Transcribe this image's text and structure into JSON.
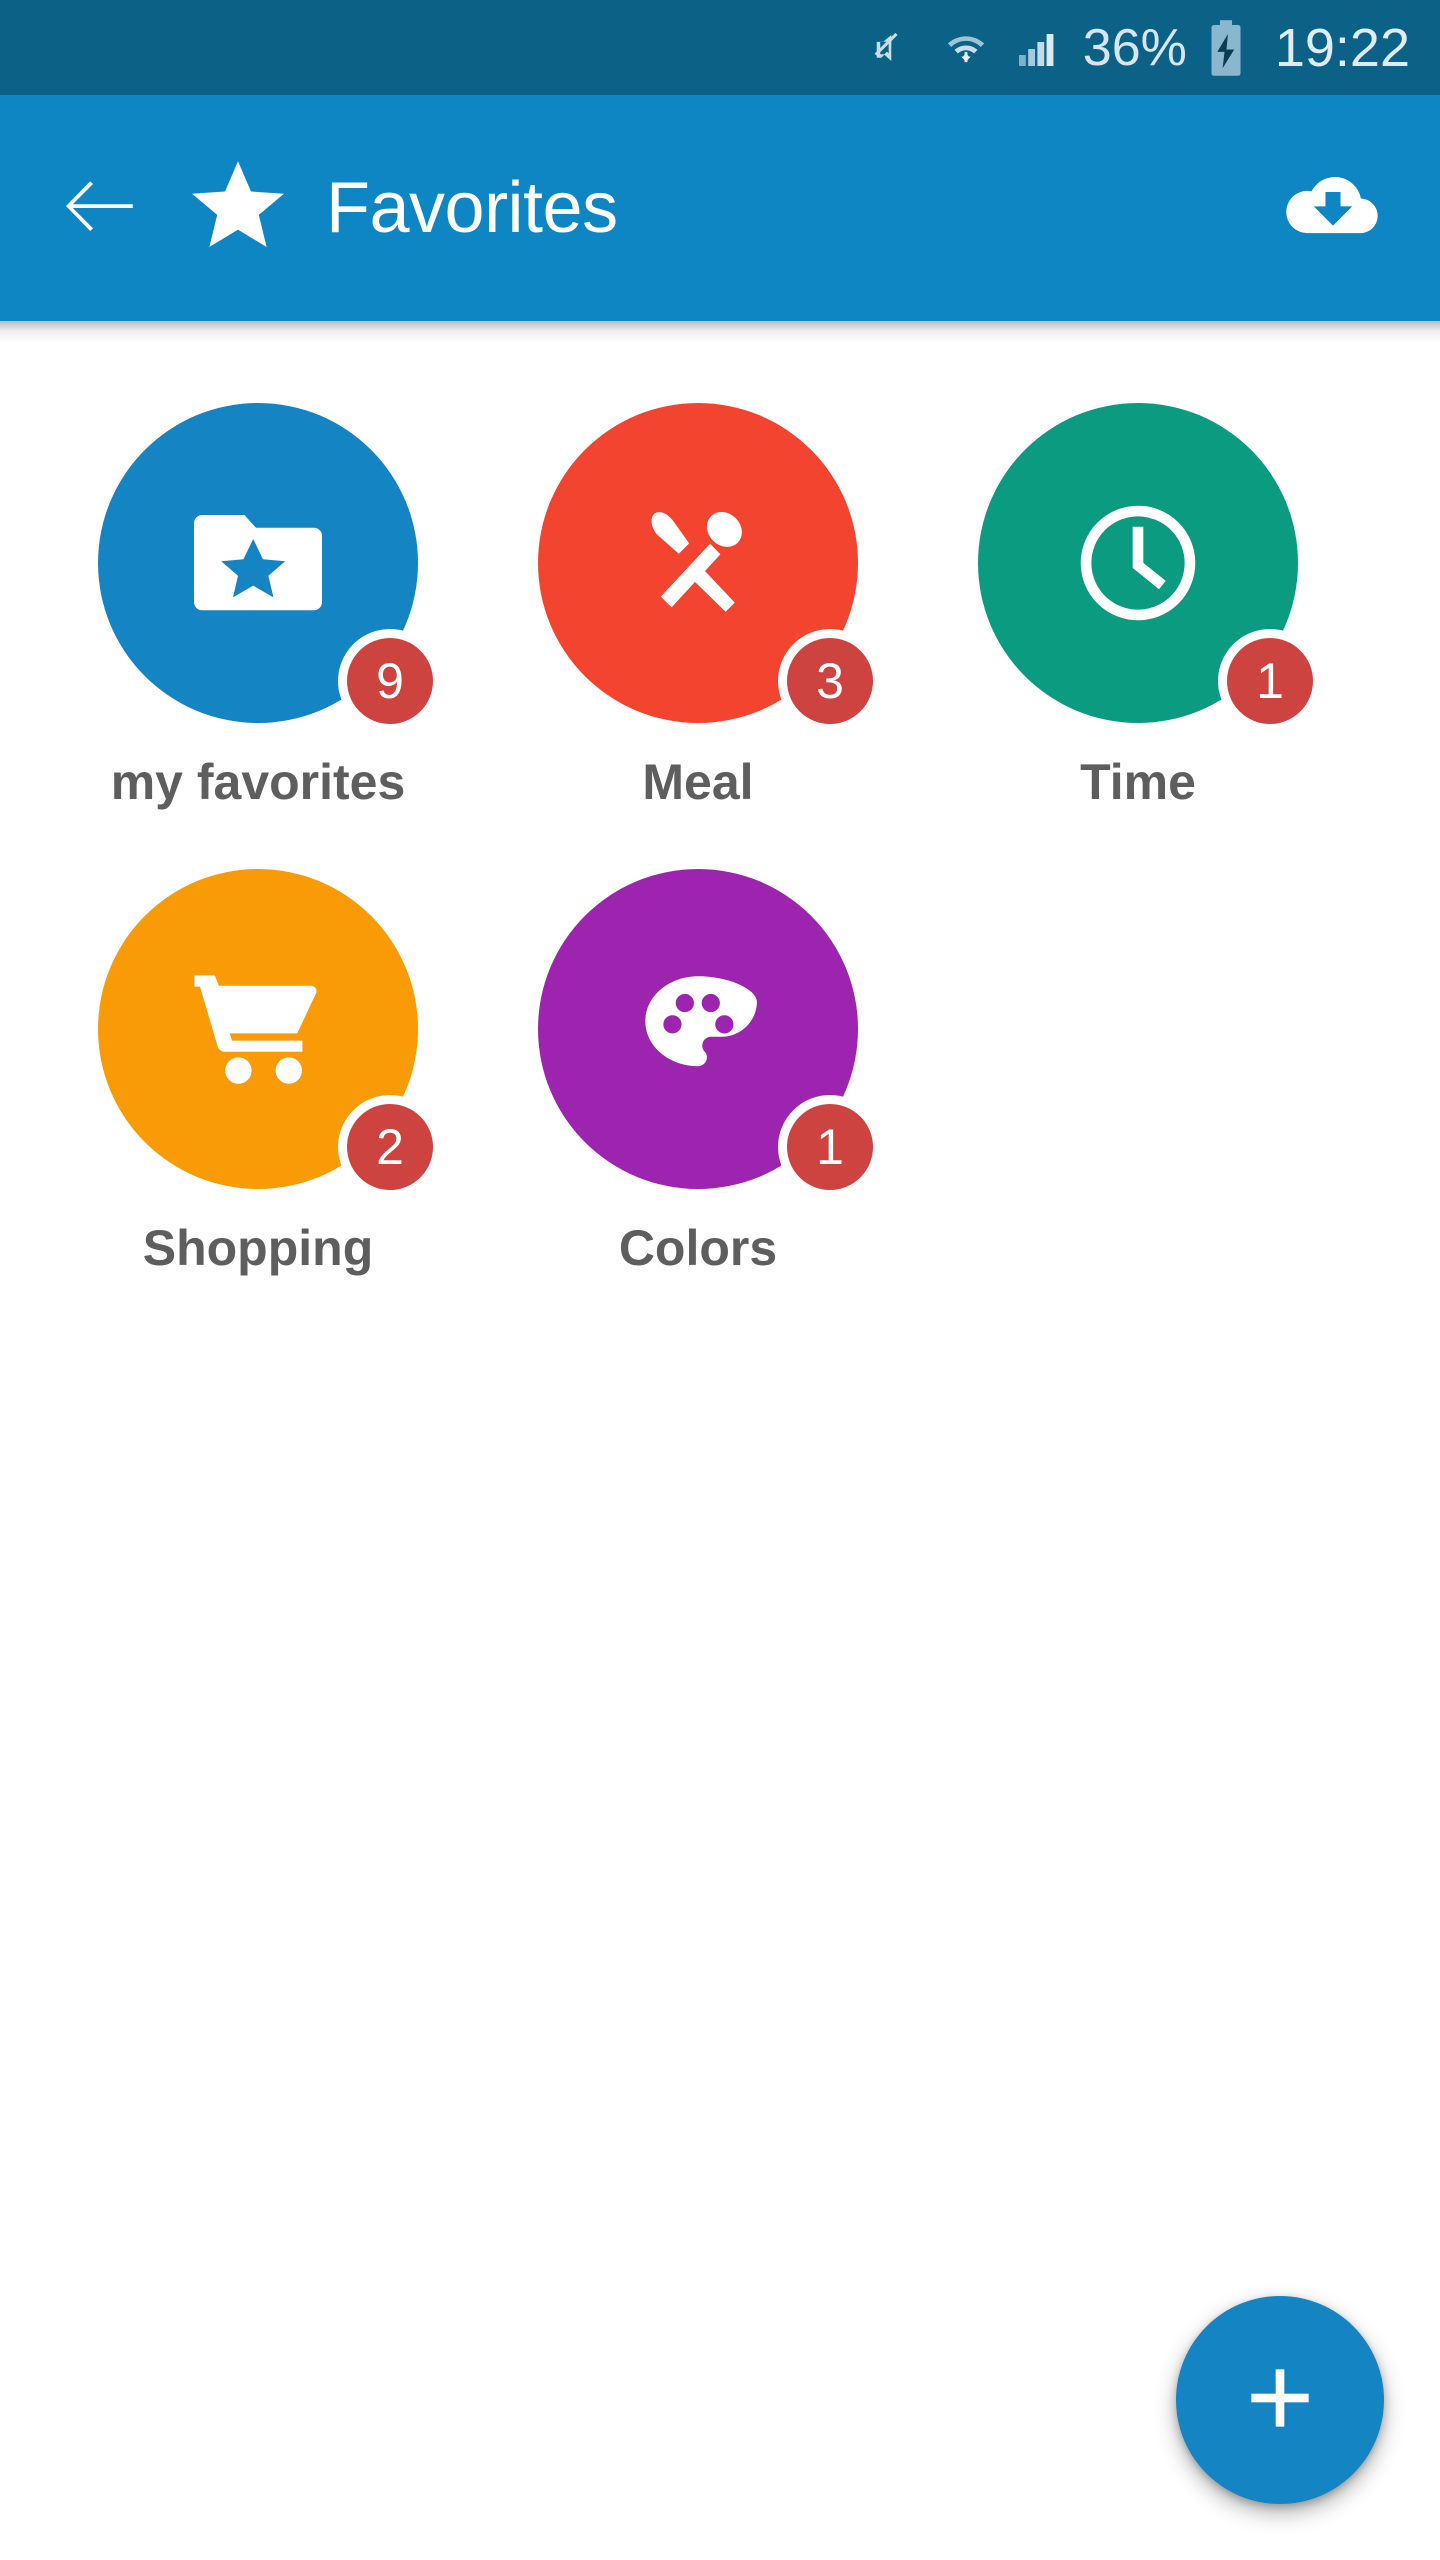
{
  "status_bar": {
    "battery_percent": "36%",
    "clock": "19:22",
    "icons": [
      "mute-icon",
      "wifi-icon",
      "cellular-signal-icon",
      "battery-charging-icon"
    ],
    "background_color": "#0b6286",
    "text_color": "#d7e6ee"
  },
  "app_bar": {
    "title": "Favorites",
    "back_icon": "arrow-left-icon",
    "title_icon": "star-icon",
    "action_icon": "cloud-download-icon",
    "background_color": "#0e86c3",
    "text_color": "#ffffff"
  },
  "grid": {
    "items": [
      {
        "label": "my favorites",
        "badge": "9",
        "color": "#1484c3",
        "icon": "folder-star-icon"
      },
      {
        "label": "Meal",
        "badge": "3",
        "color": "#f2442f",
        "icon": "knife-spoon-icon"
      },
      {
        "label": "Time",
        "badge": "1",
        "color": "#0b9b81",
        "icon": "clock-icon"
      },
      {
        "label": "Shopping",
        "badge": "2",
        "color": "#f99b06",
        "icon": "shopping-cart-icon"
      },
      {
        "label": "Colors",
        "badge": "1",
        "color": "#9c24ae",
        "icon": "palette-icon"
      }
    ],
    "badge_color": "#cd4340",
    "badge_text_color": "#ffffff",
    "label_color": "#5e5e5e"
  },
  "fab": {
    "icon": "plus-icon",
    "color": "#1484c3",
    "label": "+"
  }
}
